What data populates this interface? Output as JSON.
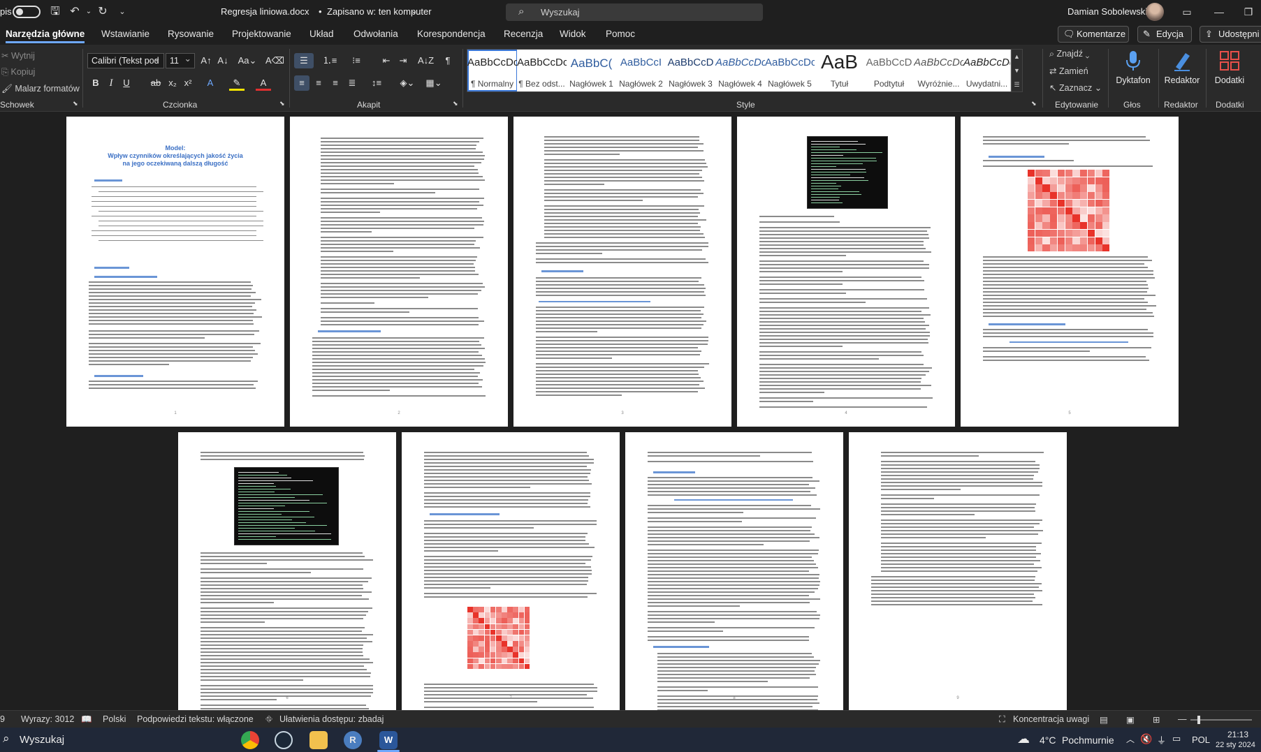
{
  "titlebar": {
    "left_fragment": "pis",
    "document": "Regresja liniowa.docx",
    "save_state": "Zapisano w: ten komputer",
    "search_label": "Wyszukaj",
    "user_name": "Damian Sobolewski"
  },
  "tabs": [
    "Narzędzia główne",
    "Wstawianie",
    "Rysowanie",
    "Projektowanie",
    "Układ",
    "Odwołania",
    "Korespondencja",
    "Recenzja",
    "Widok",
    "Pomoc"
  ],
  "tab_buttons": {
    "comments": "Komentarze",
    "editing": "Edycja",
    "share": "Udostępni"
  },
  "ribbon": {
    "clipboard": {
      "cut": "Wytnij",
      "copy": "Kopiuj",
      "format_painter": "Malarz formatów",
      "label": "Schowek"
    },
    "font": {
      "family": "Calibri (Tekst pod",
      "size": "11",
      "label": "Czcionka"
    },
    "paragraph": {
      "label": "Akapit"
    },
    "styles": {
      "label": "Style",
      "items": [
        {
          "preview": "AaBbCcDc",
          "name": "¶ Normalny"
        },
        {
          "preview": "AaBbCcDc",
          "name": "¶ Bez odst..."
        },
        {
          "preview": "AaBbC(",
          "name": "Nagłówek 1"
        },
        {
          "preview": "AaBbCcI",
          "name": "Nagłówek 2"
        },
        {
          "preview": "AaBbCcD",
          "name": "Nagłówek 3"
        },
        {
          "preview": "AaBbCcDc",
          "name": "Nagłówek 4"
        },
        {
          "preview": "AaBbCcDc",
          "name": "Nagłówek 5"
        },
        {
          "preview": "AaB",
          "name": "Tytuł"
        },
        {
          "preview": "AaBbCcD",
          "name": "Podtytuł"
        },
        {
          "preview": "AaBbCcDc",
          "name": "Wyróżnie..."
        },
        {
          "preview": "AaBbCcDc",
          "name": "Uwydatni..."
        }
      ]
    },
    "editing": {
      "find": "Znajdź",
      "replace": "Zamień",
      "select": "Zaznacz",
      "label": "Edytowanie"
    },
    "voice": {
      "dictate": "Dyktafon",
      "label": "Głos"
    },
    "editor": {
      "name": "Redaktor",
      "label": "Redaktor"
    },
    "addins": {
      "name": "Dodatki",
      "label": "Dodatki"
    }
  },
  "document": {
    "page1_title": "Model:\nWpływ czynników określających jakość życia\nna jego oczekiwaną dalszą długość",
    "page_numbers": [
      "1",
      "2",
      "3",
      "4",
      "5",
      "6",
      "7",
      "8",
      "9"
    ]
  },
  "statusbar": {
    "page_fragment": "9",
    "words": "Wyrazy: 3012",
    "language": "Polski",
    "text_predictions": "Podpowiedzi tekstu: włączone",
    "accessibility": "Ułatwienia dostępu: zbadaj",
    "focus": "Koncentracja uwagi"
  },
  "taskbar": {
    "search": "Wyszukaj",
    "temperature": "4°C",
    "weather": "Pochmurnie",
    "language": "POL",
    "time": "21:13",
    "date": "22 sty 2024"
  },
  "colors": {
    "accent": "#6ea8fe",
    "title_blue": "#3a6fc4",
    "heatmap_red": "#e8332a"
  }
}
